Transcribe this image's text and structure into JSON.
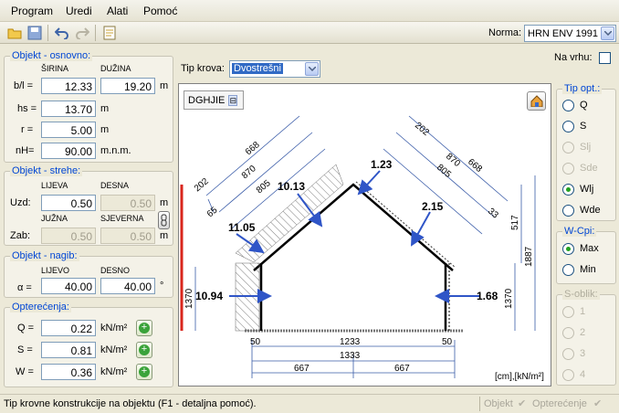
{
  "menu": {
    "items": [
      "Program",
      "Uredi",
      "Alati",
      "Pomoć"
    ]
  },
  "toolbar": {
    "norma_label": "Norma:",
    "norma_value": "HRN ENV 1991"
  },
  "objekt_osnovno": {
    "title": "Objekt - osnovno:",
    "col_sirina": "ŠIRINA",
    "col_duzina": "DUŽINA",
    "bl_label": "b/l =",
    "b_value": "12.33",
    "l_value": "19.20",
    "bl_unit": "m",
    "hs_label": "hs =",
    "hs_value": "13.70",
    "hs_unit": "m",
    "r_label": "r =",
    "r_value": "5.00",
    "r_unit": "m",
    "nh_label": "nH=",
    "nh_value": "90.00",
    "nh_unit": "m.n.m."
  },
  "objekt_strehe": {
    "title": "Objekt - strehe:",
    "col_lijeva": "LIJEVA",
    "col_desna": "DESNA",
    "uzd_label": "Uzd:",
    "uzd_lijeva": "0.50",
    "uzd_desna": "0.50",
    "uzd_unit": "m",
    "col_juzna": "JUŽNA",
    "col_sjeverna": "SJEVERNA",
    "zab_label": "Zab:",
    "zab_juzna": "0.50",
    "zab_sjeverna": "0.50",
    "zab_unit": "m"
  },
  "objekt_nagib": {
    "title": "Objekt - nagib:",
    "col_lijevo": "LIJEVO",
    "col_desno": "DESNO",
    "alpha_label": "α =",
    "lijevo": "40.00",
    "desno": "40.00",
    "unit": "°"
  },
  "opterecenja": {
    "title": "Opterećenja:",
    "q_label": "Q =",
    "q_value": "0.22",
    "q_unit": "kN/m²",
    "s_label": "S =",
    "s_value": "0.81",
    "s_unit": "kN/m²",
    "w_label": "W =",
    "w_value": "0.36",
    "w_unit": "kN/m²"
  },
  "tip_krova": {
    "label": "Tip krova:",
    "value": "Dvostrešni"
  },
  "na_vrhu": {
    "label": "Na vrhu:"
  },
  "drawing": {
    "tab_label": "DGHJIE",
    "units_label": "[cm],[kN/m²]",
    "load_left_wall": "10.94",
    "load_right_wall": "1.68",
    "load_left_roof_low": "11.05",
    "load_left_roof_high": "10.13",
    "load_apex": "1.23",
    "load_right_roof": "2.15",
    "dim_202_l": "202",
    "dim_668_l": "668",
    "dim_870_l": "870",
    "dim_805_l": "805",
    "dim_65": "65",
    "dim_202_r": "202",
    "dim_668_r": "668",
    "dim_870_r": "870",
    "dim_805_r": "805",
    "dim_33": "33",
    "dim_1370_l": "1370",
    "dim_1370_r": "1370",
    "dim_1887": "1887",
    "dim_517": "517",
    "dim_50_l": "50",
    "dim_1233": "1233",
    "dim_50_r": "50",
    "dim_1333": "1333",
    "dim_667_l": "667",
    "dim_667_r": "667"
  },
  "tip_opt": {
    "title": "Tip opt.:",
    "options": [
      "Q",
      "S",
      "Slj",
      "Sde",
      "Wlj",
      "Wde"
    ],
    "selected": "Wlj"
  },
  "w_cpi": {
    "title": "W-Cpi:",
    "options": [
      "Max",
      "Min"
    ],
    "selected": "Max"
  },
  "s_oblik": {
    "title": "S-oblik:",
    "options": [
      "1",
      "2",
      "3",
      "4"
    ]
  },
  "status": {
    "text": "Tip krovne konstrukcije na objektu (F1 - detaljna pomoć).",
    "objekt": "Objekt",
    "opterecenje": "Opterećenje"
  }
}
